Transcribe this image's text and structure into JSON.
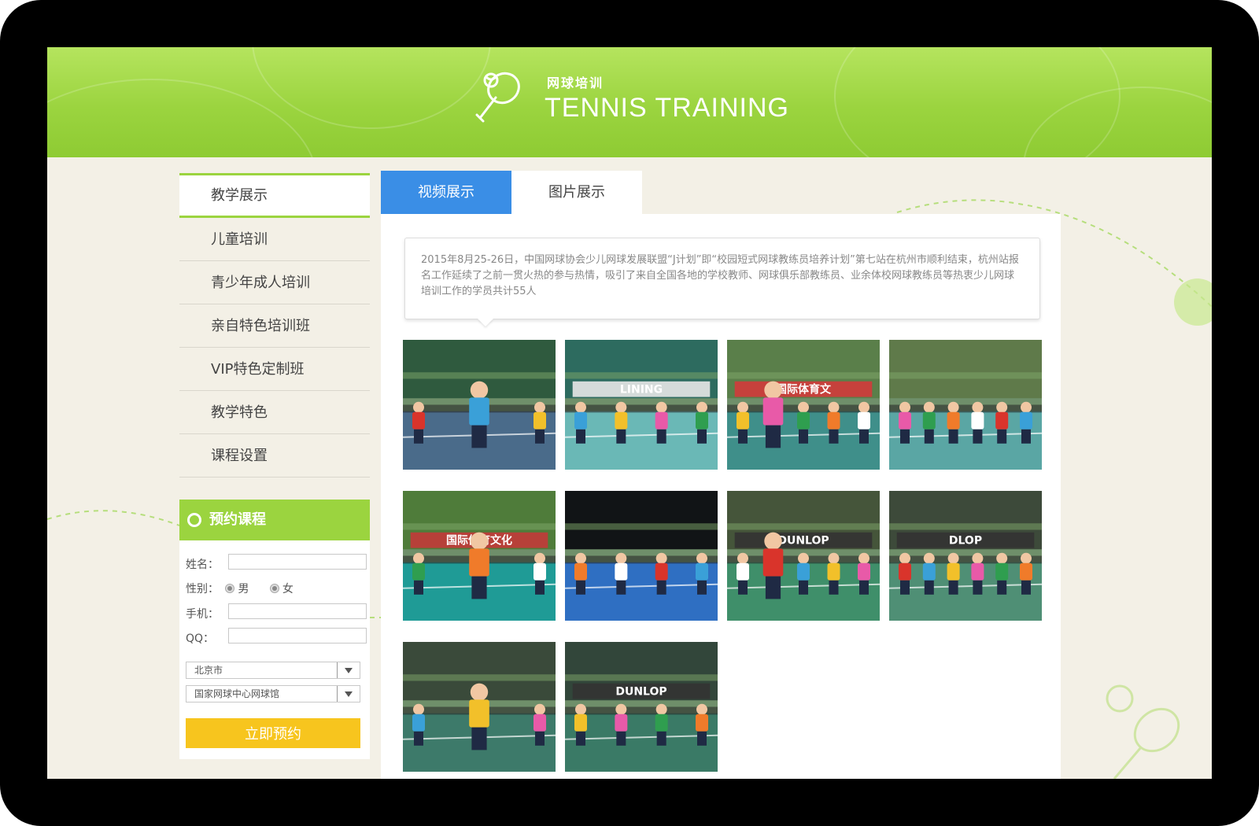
{
  "header": {
    "title_cn": "网球培训",
    "title_en": "TENNIS TRAINING"
  },
  "sidebar": {
    "items": [
      {
        "label": "教学展示",
        "active": true
      },
      {
        "label": "儿童培训",
        "active": false
      },
      {
        "label": "青少年成人培训",
        "active": false
      },
      {
        "label": "亲自特色培训班",
        "active": false
      },
      {
        "label": "VIP特色定制班",
        "active": false
      },
      {
        "label": "教学特色",
        "active": false
      },
      {
        "label": "课程设置",
        "active": false
      }
    ]
  },
  "booking": {
    "title": "预约课程",
    "name_label": "姓名：",
    "name_value": "",
    "gender_label": "性别：",
    "gender_options": [
      "男",
      "女"
    ],
    "phone_label": "手机：",
    "phone_value": "",
    "qq_label": "QQ：",
    "qq_value": "",
    "city_select": "北京市",
    "venue_select": "国家网球中心网球馆",
    "submit_label": "立即预约"
  },
  "tabs": [
    {
      "label": "视频展示",
      "active": true
    },
    {
      "label": "图片展示",
      "active": false
    }
  ],
  "description": "2015年8月25-26日，中国网球协会少儿网球发展联盟“J计划”即“校园短式网球教练员培养计划”第七站在杭州市顺利结束，杭州站报名工作延续了之前一贯火热的参与热情，吸引了来自全国各地的学校教师、网球俱乐部教练员、业余体校网球教练员等热衷少儿网球培训工作的学员共计55人",
  "photos": [
    {
      "name": "kids-indoor-court",
      "court": "#4a6b8a",
      "wall": "#2f5a3e",
      "sign": "",
      "sign_color": "#c8e0f2"
    },
    {
      "name": "coach-red-shirt-lining",
      "court": "#6ab8b6",
      "wall": "#2d6b5f",
      "sign": "LINING",
      "sign_color": "#e8e8e8"
    },
    {
      "name": "coach-green-shirt-banner",
      "court": "#3f8f8a",
      "wall": "#5a7f4a",
      "sign": "国际体育文",
      "sign_color": "#d23b3b"
    },
    {
      "name": "kids-sitting-court",
      "court": "#5aa6a4",
      "wall": "#5f7a4a",
      "sign": "",
      "sign_color": "#c03030"
    },
    {
      "name": "coach-portrait-cap",
      "court": "#1f9b96",
      "wall": "#4f7c3a",
      "sign": "国际体育文化",
      "sign_color": "#c23a3a"
    },
    {
      "name": "group-photo-blue-court",
      "court": "#2f6fc2",
      "wall": "#111416",
      "sign": "",
      "sign_color": "#1e1e1e"
    },
    {
      "name": "kids-practice-green",
      "court": "#3f8f6a",
      "wall": "#45553a",
      "sign": "DUNLOP",
      "sign_color": "#333"
    },
    {
      "name": "coach-kneeling-kids",
      "court": "#4f8f75",
      "wall": "#3d4a3a",
      "sign": "DLOP",
      "sign_color": "#333"
    },
    {
      "name": "kid-pink-skirt-coach",
      "court": "#3d7a6a",
      "wall": "#3a4a3a",
      "sign": "",
      "sign_color": "#333"
    },
    {
      "name": "kids-line-net",
      "court": "#3a7a66",
      "wall": "#32463a",
      "sign": "DUNLOP",
      "sign_color": "#333"
    }
  ],
  "colors": {
    "accent_green": "#9bd43f",
    "tab_blue": "#3a8ee6",
    "button_yellow": "#f7c51e"
  }
}
